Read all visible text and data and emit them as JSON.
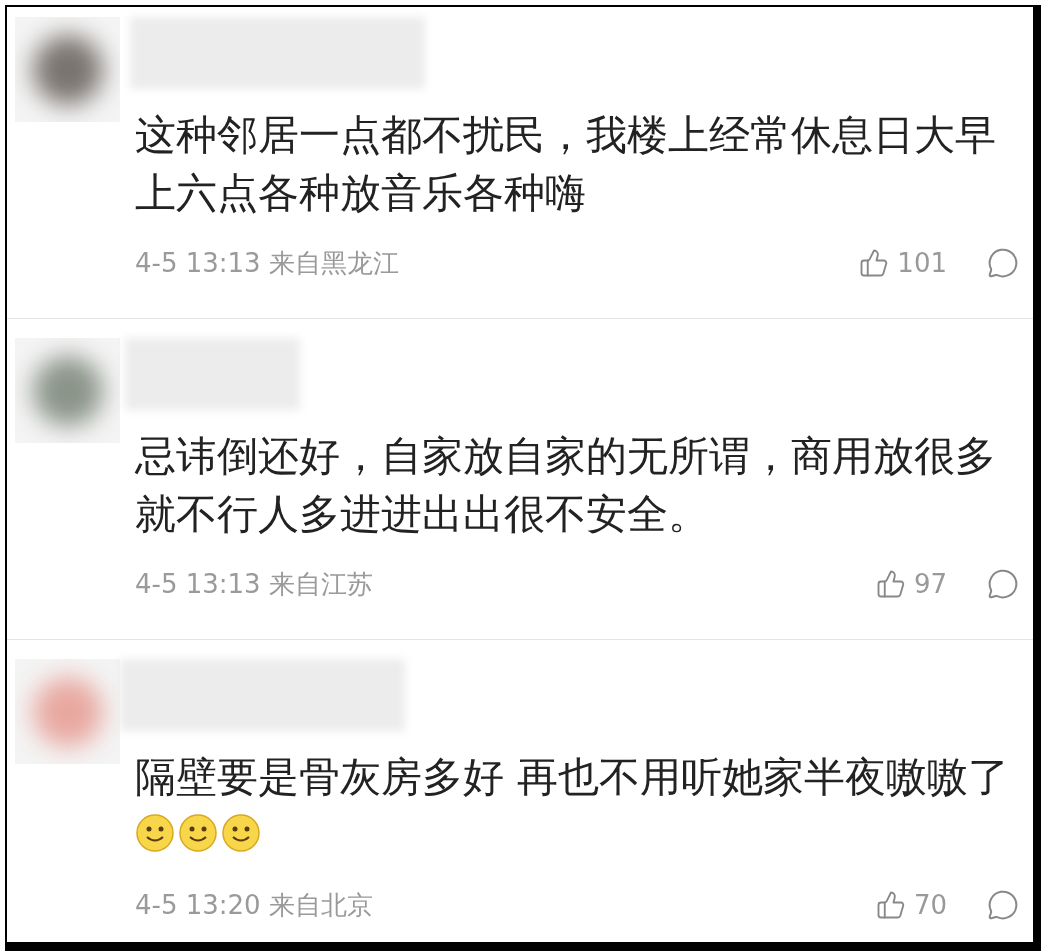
{
  "comments": [
    {
      "text": "这种邻居一点都不扰民，我楼上经常休息日大早上六点各种放音乐各种嗨",
      "meta": "4-5 13:13 来自黑龙江",
      "likes": "101"
    },
    {
      "text": "忌讳倒还好，自家放自家的无所谓，商用放很多就不行人多进进出出很不安全。",
      "meta": "4-5 13:13 来自江苏",
      "likes": "97"
    },
    {
      "text": "隔壁要是骨灰房多好 再也不用听她家半夜嗷嗷了",
      "emojis": [
        {
          "kind": "smile"
        },
        {
          "kind": "smile"
        },
        {
          "kind": "smile"
        }
      ],
      "meta": "4-5 13:20 来自北京",
      "likes": "70"
    }
  ]
}
